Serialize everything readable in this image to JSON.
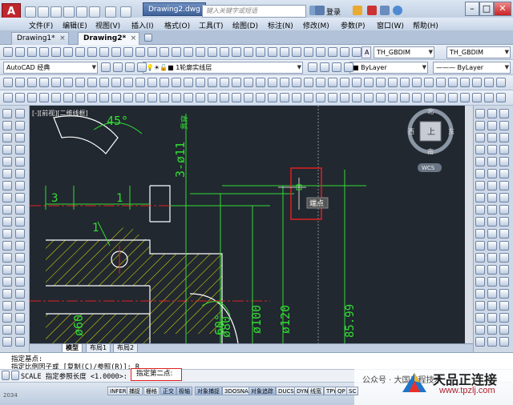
{
  "title_bar": {
    "app_title": "Drawing2.dwg",
    "search_placeholder": "键入关键字或短语",
    "login": "登录"
  },
  "menu": [
    "文件(F)",
    "编辑(E)",
    "视图(V)",
    "插入(I)",
    "格式(O)",
    "工具(T)",
    "绘图(D)",
    "标注(N)",
    "修改(M)",
    "参数(P)",
    "窗口(W)",
    "帮助(H)"
  ],
  "tabs": [
    "Drawing1*",
    "Drawing2*"
  ],
  "toolbar": {
    "textstyle": "TH_GBDIM",
    "dimstyle": "TH_GBDIM",
    "workspace": "AutoCAD 经典",
    "layer": "1轮廓实线层",
    "color": "ByLayer",
    "linetype": "ByLayer",
    "lineweight": "ByLayer"
  },
  "viewport_label": "[-][前视][二维线框]",
  "viewcube": {
    "n": "北",
    "s": "南",
    "w": "西",
    "e": "东",
    "top": "上",
    "wcs": "WCS"
  },
  "drawing": {
    "angle": "45°",
    "angle2": "60°",
    "d1": "3-ø11",
    "d1b": "贯穿",
    "d2": "3",
    "d3": "1",
    "d4": "1",
    "d5": "ø60",
    "d6": "ø80",
    "d7": "ø100",
    "d8": "ø120",
    "d9": "85.99",
    "snap": "端点"
  },
  "layout_tabs": [
    "模型",
    "布局1",
    "布局2"
  ],
  "command": {
    "line1": "指定基点:",
    "line2": "指定比例因子或 [复制(C)/参照(R)]: R",
    "prompt": "SCALE 指定参照长度 <1.0000>:",
    "input": "指定第二点:"
  },
  "status": [
    "INFER",
    "捕捉",
    "栅格",
    "正交",
    "极轴",
    "对象捕捉",
    "3DOSNAP",
    "对象追踪",
    "DUCS",
    "DYN",
    "线宽",
    "TPY",
    "QP",
    "SC"
  ],
  "status_on": [
    "正交",
    "极轴",
    "对象捕捉",
    "对象追踪"
  ],
  "status_left": "2034",
  "watermark": {
    "title": "天品正连接",
    "url": "www.tpzlj.com",
    "note": "公众号 · 大国工程技术"
  }
}
